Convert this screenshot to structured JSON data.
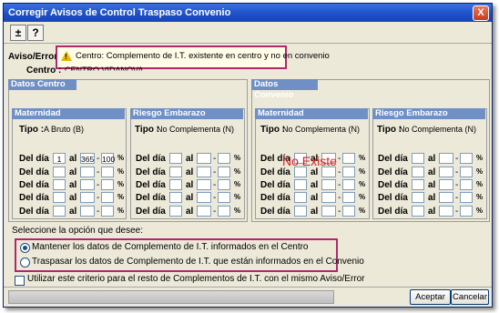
{
  "window": {
    "title": "Corregir Avisos de Control Traspaso Convenio",
    "close_label": "X"
  },
  "toolbar": {
    "expand_label": "±",
    "help_label": "?"
  },
  "header": {
    "aviso_label": "Aviso/Error :",
    "aviso_icon_label": "!",
    "aviso_text": "Centro: Complemento de I.T. existente en centro y no en convenio",
    "centro_label": "Centro :",
    "centro_value": "CENTRO VIDANOVA"
  },
  "datos_centro": {
    "title": "Datos Centro",
    "maternidad": {
      "title": "Maternidad",
      "tipo_label": "Tipo :",
      "tipo_value": "A Bruto (B)",
      "rows": [
        {
          "label": "Del día",
          "from": "1",
          "al": "al",
          "to": "365",
          "sep": "-",
          "pct": "100",
          "pct_sign": "%"
        },
        {
          "label": "Del día",
          "from": "",
          "al": "al",
          "to": "",
          "sep": "-",
          "pct": "",
          "pct_sign": "%"
        },
        {
          "label": "Del día",
          "from": "",
          "al": "al",
          "to": "",
          "sep": "-",
          "pct": "",
          "pct_sign": "%"
        },
        {
          "label": "Del día",
          "from": "",
          "al": "al",
          "to": "",
          "sep": "-",
          "pct": "",
          "pct_sign": "%"
        },
        {
          "label": "Del día",
          "from": "",
          "al": "al",
          "to": "",
          "sep": "-",
          "pct": "",
          "pct_sign": "%"
        }
      ]
    },
    "riesgo": {
      "title": "Riesgo Embarazo",
      "tipo_label": "Tipo :",
      "tipo_value": "No Complementa (N)",
      "rows": [
        {
          "label": "Del día",
          "from": "",
          "al": "al",
          "to": "",
          "sep": "-",
          "pct": "",
          "pct_sign": "%"
        },
        {
          "label": "Del día",
          "from": "",
          "al": "al",
          "to": "",
          "sep": "-",
          "pct": "",
          "pct_sign": "%"
        },
        {
          "label": "Del día",
          "from": "",
          "al": "al",
          "to": "",
          "sep": "-",
          "pct": "",
          "pct_sign": "%"
        },
        {
          "label": "Del día",
          "from": "",
          "al": "al",
          "to": "",
          "sep": "-",
          "pct": "",
          "pct_sign": "%"
        },
        {
          "label": "Del día",
          "from": "",
          "al": "al",
          "to": "",
          "sep": "-",
          "pct": "",
          "pct_sign": "%"
        }
      ]
    }
  },
  "datos_convenio": {
    "title": "Datos Convenio",
    "no_existe": "No Existe",
    "maternidad": {
      "title": "Maternidad",
      "tipo_label": "Tipo :",
      "tipo_value": "No Complementa (N)",
      "rows": [
        {
          "label": "Del día",
          "from": "",
          "al": "al",
          "to": "",
          "sep": "-",
          "pct": "",
          "pct_sign": "%"
        },
        {
          "label": "Del día",
          "from": "",
          "al": "al",
          "to": "",
          "sep": "-",
          "pct": "",
          "pct_sign": "%"
        },
        {
          "label": "Del día",
          "from": "",
          "al": "al",
          "to": "",
          "sep": "-",
          "pct": "",
          "pct_sign": "%"
        },
        {
          "label": "Del día",
          "from": "",
          "al": "al",
          "to": "",
          "sep": "-",
          "pct": "",
          "pct_sign": "%"
        },
        {
          "label": "Del día",
          "from": "",
          "al": "al",
          "to": "",
          "sep": "-",
          "pct": "",
          "pct_sign": "%"
        }
      ]
    },
    "riesgo": {
      "title": "Riesgo Embarazo",
      "tipo_label": "Tipo :",
      "tipo_value": "No Complementa (N)",
      "rows": [
        {
          "label": "Del día",
          "from": "",
          "al": "al",
          "to": "",
          "sep": "-",
          "pct": "",
          "pct_sign": "%"
        },
        {
          "label": "Del día",
          "from": "",
          "al": "al",
          "to": "",
          "sep": "-",
          "pct": "",
          "pct_sign": "%"
        },
        {
          "label": "Del día",
          "from": "",
          "al": "al",
          "to": "",
          "sep": "-",
          "pct": "",
          "pct_sign": "%"
        },
        {
          "label": "Del día",
          "from": "",
          "al": "al",
          "to": "",
          "sep": "-",
          "pct": "",
          "pct_sign": "%"
        },
        {
          "label": "Del día",
          "from": "",
          "al": "al",
          "to": "",
          "sep": "-",
          "pct": "",
          "pct_sign": "%"
        }
      ]
    }
  },
  "options": {
    "prompt": "Seleccione la opción que desee:",
    "opt1": "Mantener los datos de Complemento de I.T. informados en el Centro",
    "opt2": "Traspasar los datos de Complemento de I.T. que están informados en el Convenio",
    "criterio": "Utilizar este criterio para el resto de Complementos de I.T. con el mismo Aviso/Error"
  },
  "buttons": {
    "accept": "Aceptar",
    "cancel": "Cancelar"
  },
  "colors": {
    "title_bar": "#1c4fc8",
    "group_header": "#6f8fc5",
    "highlight": "#b0286c",
    "no_existe": "#e02020"
  }
}
